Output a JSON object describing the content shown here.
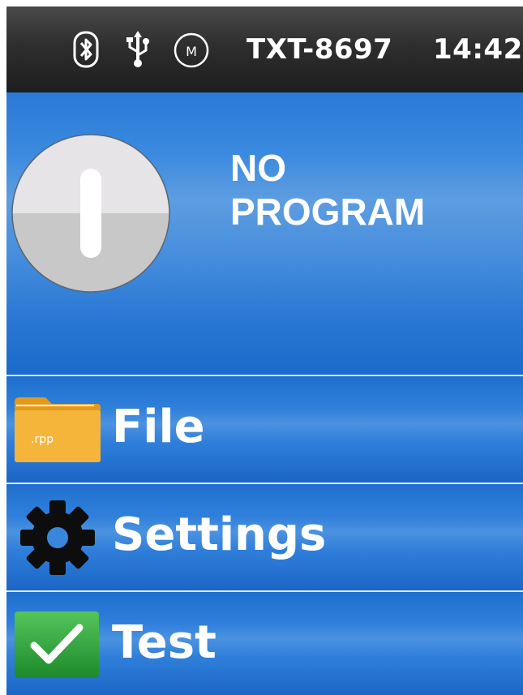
{
  "status_bar": {
    "icons": [
      "bluetooth-icon",
      "usb-icon",
      "m-badge-icon"
    ],
    "m_badge_letter": "M",
    "device_name": "TXT-8697",
    "time": "14:42"
  },
  "program": {
    "status_line1": "NO",
    "status_line2": "PROGRAM",
    "control_icon": "power-knob-icon"
  },
  "menu": {
    "items": [
      {
        "label": "File",
        "icon": "folder-icon",
        "icon_text": ".rpp",
        "icon_color": "#f2b02c"
      },
      {
        "label": "Settings",
        "icon": "gear-icon",
        "icon_color": "#111111"
      },
      {
        "label": "Test",
        "icon": "checkmark-icon",
        "icon_color": "#2e9a3a"
      }
    ]
  },
  "colors": {
    "status_bar_bg": "#2e2e2e",
    "panel_blue": "#2a7ad6",
    "row_divider": "#dfe9f7"
  }
}
